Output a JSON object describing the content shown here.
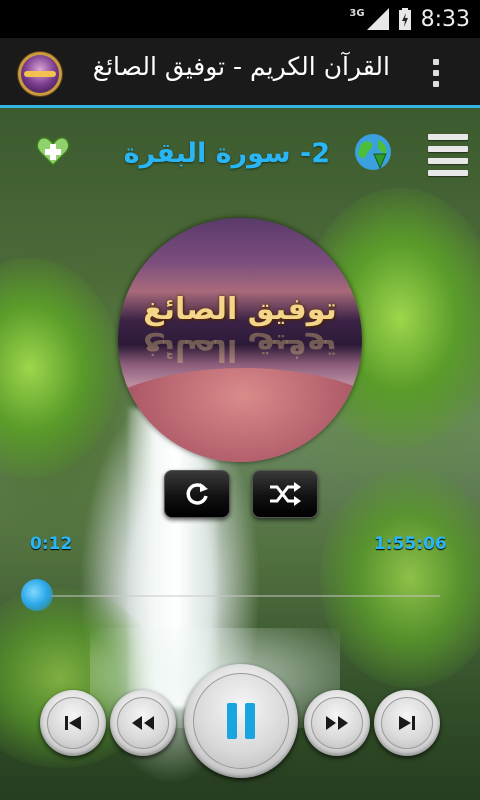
{
  "status_bar": {
    "network": "3G",
    "time": "8:33"
  },
  "action_bar": {
    "title": "القرآن الكريم - توفيق الصائغ",
    "app_icon": "reciter-app-icon",
    "menu_icon": "overflow-menu-icon"
  },
  "player": {
    "surah_title": "2- سورة البقرة",
    "reciter_name": "توفيق الصائغ",
    "elapsed": "0:12",
    "duration": "1:55:06",
    "progress": 0.002
  },
  "icons": {
    "add_favorite": "heart-plus-icon",
    "download": "globe-download-icon",
    "playlist": "list-menu-icon",
    "repeat": "repeat-icon",
    "shuffle": "shuffle-icon",
    "prev": "skip-previous-icon",
    "rewind": "rewind-icon",
    "pause": "pause-icon",
    "forward": "fast-forward-icon",
    "next": "skip-next-icon"
  },
  "colors": {
    "accent": "#29b6f6",
    "action_bar": "#1a1a1a"
  }
}
